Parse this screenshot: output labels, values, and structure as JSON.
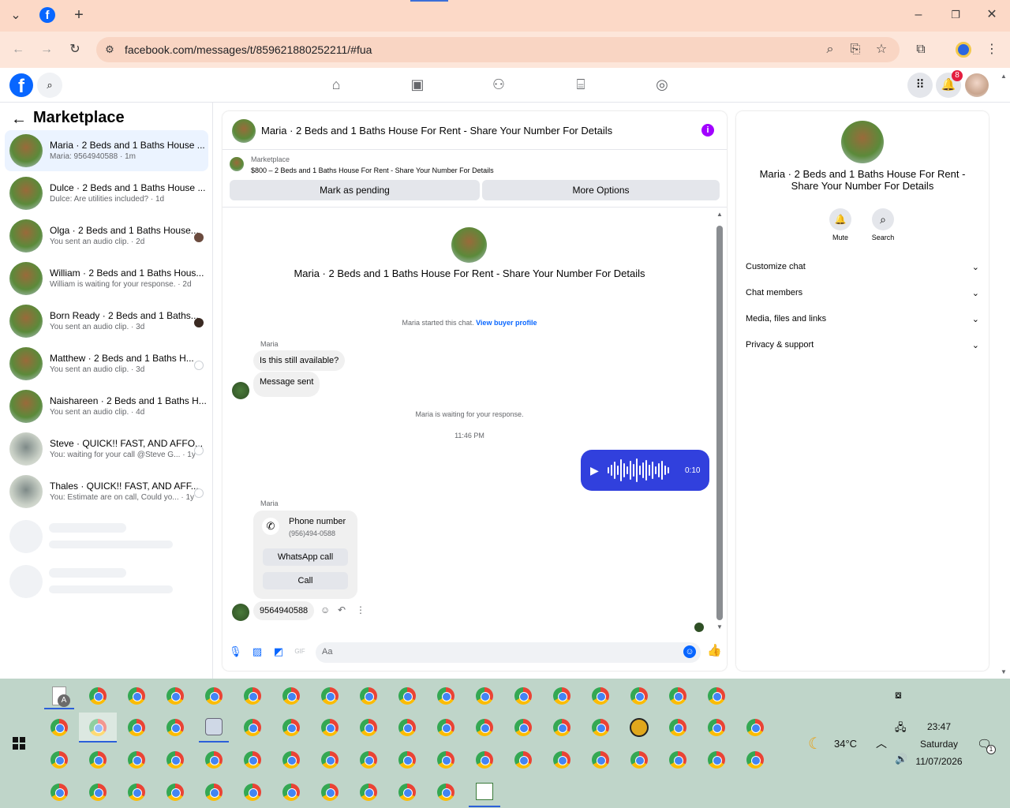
{
  "browser": {
    "url": "facebook.com/messages/t/859621880252211/#fua"
  },
  "fbnav": {
    "notification_count": "8"
  },
  "sidebar": {
    "title": "Marketplace",
    "conversations": [
      {
        "name": "Maria · 2 Beds and 1 Baths House ...",
        "preview": "Maria: 9564940588 · 1m"
      },
      {
        "name": "Dulce · 2 Beds and 1 Baths House ...",
        "preview": "Dulce: Are utilities included? · 1d"
      },
      {
        "name": "Olga · 2 Beds and 1 Baths House...",
        "preview": "You sent an audio clip. · 2d"
      },
      {
        "name": "William · 2 Beds and 1 Baths Hous...",
        "preview": "William is waiting for your response. · 2d"
      },
      {
        "name": "Born Ready · 2 Beds and 1 Baths...",
        "preview": "You sent an audio clip. · 3d"
      },
      {
        "name": "Matthew · 2 Beds and 1 Baths H...",
        "preview": "You sent an audio clip. · 3d"
      },
      {
        "name": "Naishareen · 2 Beds and 1 Baths H...",
        "preview": "You sent an audio clip. · 4d"
      },
      {
        "name": "Steve · QUICK!! FAST, AND AFFO...",
        "preview": "You: waiting for your call @Steve G... · 1y"
      },
      {
        "name": "Thales · QUICK!! FAST, AND AFF...",
        "preview": "You: Estimate are on call, Could yo... · 1y"
      }
    ]
  },
  "chat": {
    "title": "Maria · 2 Beds and 1 Baths House For Rent - Share Your Number For Details",
    "listing_label": "Marketplace",
    "listing_title": "$800 – 2 Beds and 1 Baths House For Rent - Share Your Number For Details",
    "mark_pending": "Mark as pending",
    "more_options": "More Options",
    "intro_title": "Maria · 2 Beds and 1 Baths House For Rent - Share Your Number For Details",
    "started_text": "Maria started this chat.",
    "view_profile": "View buyer profile",
    "sender_name": "Maria",
    "msg1": "Is this still available?",
    "msg2": "Message sent",
    "waiting_text": "Maria is waiting for your response.",
    "timestamp": "11:46 PM",
    "audio_duration": "0:10",
    "sender_name2": "Maria",
    "card_title": "Phone number",
    "card_number": "(956)494-0588",
    "whatsapp": "WhatsApp call",
    "call": "Call",
    "msg3": "9564940588",
    "composer_placeholder": "Aa"
  },
  "rightpanel": {
    "title": "Maria · 2 Beds and 1 Baths House For Rent - Share Your Number For Details",
    "mute": "Mute",
    "search": "Search",
    "sections": [
      "Customize chat",
      "Chat members",
      "Media, files and links",
      "Privacy & support"
    ]
  },
  "taskbar": {
    "weather": "34°C",
    "time": "23:47",
    "day": "Saturday",
    "date": "11/07/2026",
    "notif_count": "1",
    "doc_letter": "A"
  },
  "colors": {
    "accent": "#0866ff",
    "audio_bubble": "#3140dd",
    "info": "#a100ff",
    "badge": "#e41e3f"
  }
}
